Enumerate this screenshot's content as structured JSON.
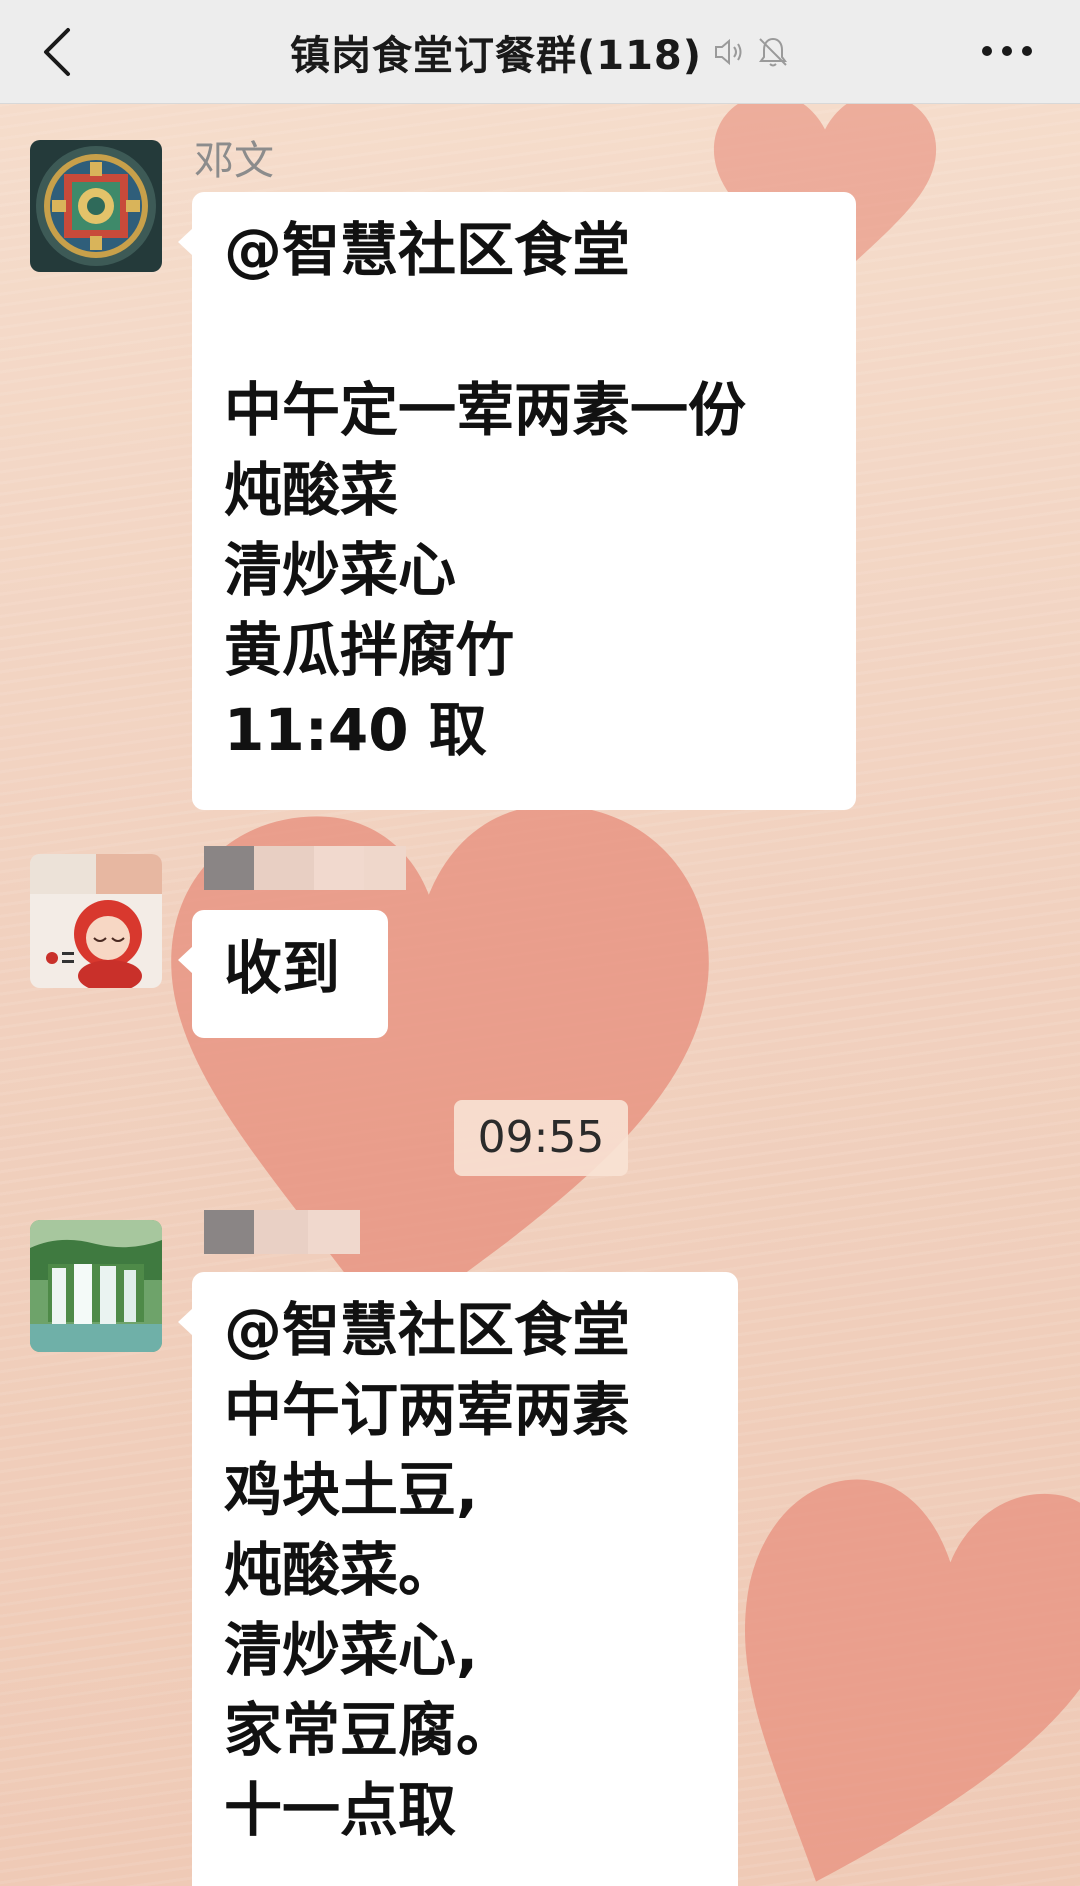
{
  "header": {
    "title": "镇岗食堂订餐群(118)",
    "icons": [
      "back-icon",
      "speaker-icon",
      "mute-bell-icon",
      "more-icon"
    ]
  },
  "messages": [
    {
      "sender": "邓文",
      "lines": [
        "@智慧社区食堂",
        "",
        "中午定一荤两素一份",
        "炖酸菜",
        "清炒菜心",
        "黄瓜拌腐竹",
        "11:40 取"
      ]
    },
    {
      "sender": "",
      "lines": [
        "收到"
      ]
    },
    {
      "sender": "",
      "lines": [
        "@智慧社区食堂",
        "中午订两荤两素",
        "鸡块土豆,",
        "炖酸菜。",
        "清炒菜心,",
        "家常豆腐。",
        "十一点取"
      ]
    }
  ],
  "timestamp": "09:55",
  "colors": {
    "header_bg": "#ededed",
    "chat_bg": "#f3d8c8",
    "bubble_bg": "#ffffff",
    "heart": "#e9917f"
  }
}
